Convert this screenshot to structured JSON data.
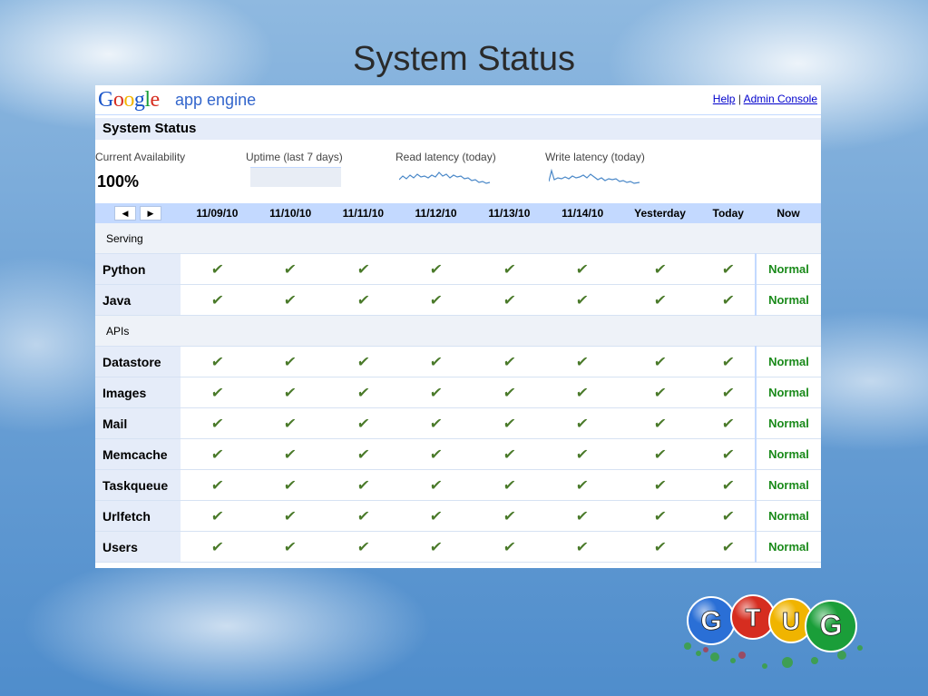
{
  "slide_title": "System Status",
  "header": {
    "logo_text": "Google",
    "product": "app engine",
    "help_link": "Help",
    "separator": "|",
    "admin_link": "Admin Console"
  },
  "section_title": "System Status",
  "stats": {
    "availability_label": "Current Availability",
    "availability_value": "100%",
    "uptime_label": "Uptime (last 7 days)",
    "read_latency_label": "Read latency (today)",
    "write_latency_label": "Write latency (today)"
  },
  "table": {
    "nav_prev": "◀",
    "nav_next": "▶",
    "columns": [
      "11/09/10",
      "11/10/10",
      "11/11/10",
      "11/12/10",
      "11/13/10",
      "11/14/10",
      "Yesterday",
      "Today",
      "Now"
    ],
    "groups": [
      {
        "name": "Serving",
        "services": [
          {
            "name": "Python",
            "now": "Normal"
          },
          {
            "name": "Java",
            "now": "Normal"
          }
        ]
      },
      {
        "name": "APIs",
        "services": [
          {
            "name": "Datastore",
            "now": "Normal"
          },
          {
            "name": "Images",
            "now": "Normal"
          },
          {
            "name": "Mail",
            "now": "Normal"
          },
          {
            "name": "Memcache",
            "now": "Normal"
          },
          {
            "name": "Taskqueue",
            "now": "Normal"
          },
          {
            "name": "Urlfetch",
            "now": "Normal"
          },
          {
            "name": "Users",
            "now": "Normal"
          }
        ]
      }
    ],
    "check_glyph": "✔"
  },
  "footer_logo": {
    "letters": [
      "G",
      "T",
      "U",
      "G"
    ],
    "colors": [
      "#2a6fd6",
      "#d62d20",
      "#f0b400",
      "#1a9e39"
    ]
  },
  "colors": {
    "header_blue": "#c3d9ff",
    "light_blue": "#e5ecf9",
    "normal_green": "#1a8a1a",
    "link_blue": "#0000cc"
  }
}
